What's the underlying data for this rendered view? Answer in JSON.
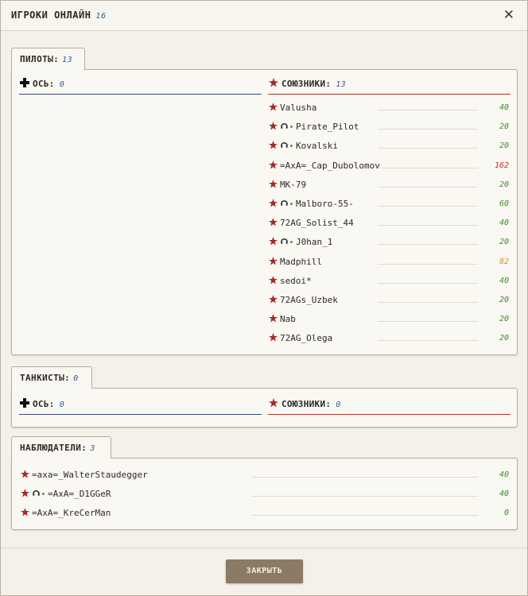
{
  "dialog": {
    "title": "ИГРОКИ ОНЛАЙН",
    "total": "16",
    "close_icon": "close-icon",
    "close_button_label": "ЗАКРЫТЬ"
  },
  "colors": {
    "axis_line": "#3a4a72",
    "allies_line": "#b3322c",
    "star": "#a52a24",
    "score_green": "#3f8a2a",
    "score_red": "#c8302a",
    "score_orange": "#e08a1e",
    "button_bg": "#8a7a66"
  },
  "pilots": {
    "label": "ПИЛОТЫ:",
    "count": "13",
    "axis": {
      "label": "ОСЬ:",
      "count": "0"
    },
    "allies": {
      "label": "СОЮЗНИКИ:",
      "count": "13",
      "players": [
        {
          "name": "Valusha",
          "score": "40",
          "star": true,
          "pilot": false,
          "score_color": "green"
        },
        {
          "name": "Pirate_Pilot",
          "score": "20",
          "star": true,
          "pilot": true,
          "score_color": "green"
        },
        {
          "name": "Kovalski",
          "score": "20",
          "star": true,
          "pilot": true,
          "score_color": "green"
        },
        {
          "name": "=AxA=_Cap_Dubolomov",
          "score": "162",
          "star": true,
          "pilot": false,
          "score_color": "red"
        },
        {
          "name": "MK-79",
          "score": "20",
          "star": true,
          "pilot": false,
          "score_color": "green"
        },
        {
          "name": "Malboro-55-",
          "score": "60",
          "star": true,
          "pilot": true,
          "score_color": "green"
        },
        {
          "name": "72AG_Solist_44",
          "score": "40",
          "star": true,
          "pilot": false,
          "score_color": "green"
        },
        {
          "name": "J0han_1",
          "score": "20",
          "star": true,
          "pilot": true,
          "score_color": "green"
        },
        {
          "name": "Madphill",
          "score": "82",
          "star": true,
          "pilot": false,
          "score_color": "orange"
        },
        {
          "name": "sedoi*",
          "score": "40",
          "star": true,
          "pilot": false,
          "score_color": "green"
        },
        {
          "name": "72AGs_Uzbek",
          "score": "20",
          "star": true,
          "pilot": false,
          "score_color": "green"
        },
        {
          "name": "Nab",
          "score": "20",
          "star": true,
          "pilot": false,
          "score_color": "green"
        },
        {
          "name": "72AG_Olega",
          "score": "20",
          "star": true,
          "pilot": false,
          "score_color": "green"
        }
      ]
    }
  },
  "tankers": {
    "label": "ТАНКИСТЫ:",
    "count": "0",
    "axis": {
      "label": "ОСЬ:",
      "count": "0"
    },
    "allies": {
      "label": "СОЮЗНИКИ:",
      "count": "0"
    }
  },
  "observers": {
    "label": "НАБЛЮДАТЕЛИ:",
    "count": "3",
    "players": [
      {
        "name": "=axa=_WalterStaudegger",
        "score": "40",
        "pilot": false,
        "score_color": "green"
      },
      {
        "name": "=AxA=_D1GGeR",
        "score": "40",
        "pilot": true,
        "score_color": "green"
      },
      {
        "name": "=AxA=_KreCerMan",
        "score": "0",
        "pilot": false,
        "score_color": "green"
      }
    ]
  }
}
